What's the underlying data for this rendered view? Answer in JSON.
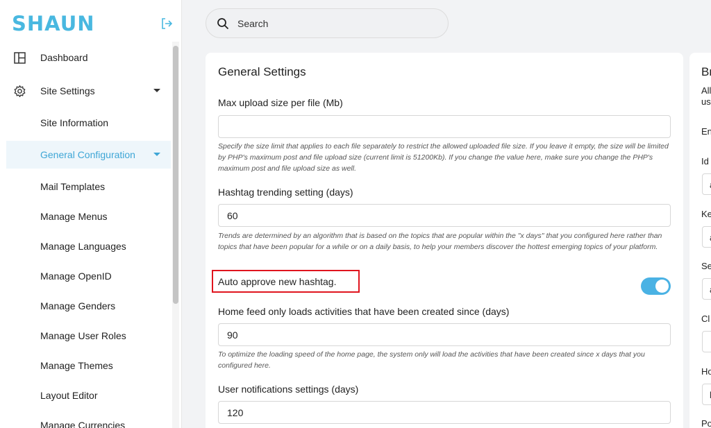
{
  "app": {
    "logo_text": "SHAUN"
  },
  "search": {
    "placeholder": "Search"
  },
  "sidebar": {
    "items": [
      {
        "label": "Dashboard"
      },
      {
        "label": "Site Settings"
      },
      {
        "label": "Site Information"
      },
      {
        "label": "General Configuration"
      },
      {
        "label": "Mail Templates"
      },
      {
        "label": "Manage Menus"
      },
      {
        "label": "Manage Languages"
      },
      {
        "label": "Manage OpenID"
      },
      {
        "label": "Manage Genders"
      },
      {
        "label": "Manage User Roles"
      },
      {
        "label": "Manage Themes"
      },
      {
        "label": "Layout Editor"
      },
      {
        "label": "Manage Currencies"
      }
    ]
  },
  "general_settings": {
    "title": "General Settings",
    "max_upload": {
      "label": "Max upload size per file (Mb)",
      "value": "",
      "hint": "Specify the size limit that applies to each file separately to restrict the allowed uploaded file size. If you leave it empty, the size will be limited by PHP's maximum post and file upload size (current limit is 51200Kb). If you change the value here, make sure you change the PHP's maximum post and file upload size as well."
    },
    "hashtag_trending": {
      "label": "Hashtag trending setting (days)",
      "value": "60",
      "hint": "Trends are determined by an algorithm that is based on the topics that are popular within the \"x days\" that you configured here rather than topics that have been popular for a while or on a daily basis, to help your members discover the hottest emerging topics of your platform."
    },
    "auto_approve": {
      "label": "Auto approve new hashtag.",
      "enabled": true
    },
    "home_feed": {
      "label": "Home feed only loads activities that have been created since (days)",
      "value": "90",
      "hint": "To optimize the loading speed of the home page, the system only will load the activities that have been created since x days that you configured here."
    },
    "user_notifications": {
      "label": "User notifications settings (days)",
      "value": "120"
    }
  },
  "right_card": {
    "title": "Br",
    "desc_line1": "All",
    "desc_line2": "us",
    "labels": [
      "En",
      "Id",
      "Ke",
      "Se",
      "Cl",
      "Ho",
      "Po"
    ],
    "input_values": [
      "a",
      "a",
      "a",
      "",
      "l"
    ]
  },
  "colors": {
    "accent": "#3ea6d6",
    "toggle_on": "#4ab2e4",
    "highlight": "#e0141e",
    "logo": "#49b8e0"
  }
}
